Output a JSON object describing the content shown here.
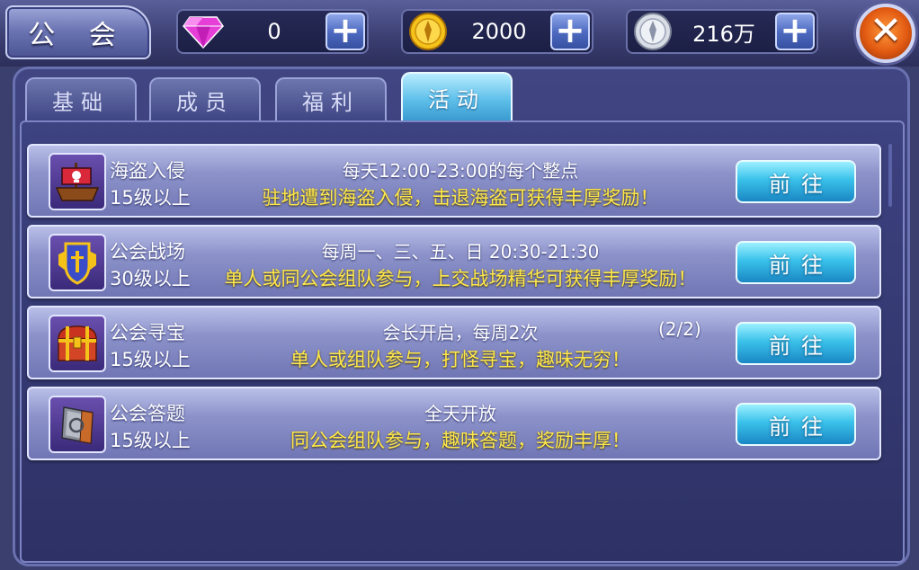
{
  "title": "公 会",
  "currencies": [
    {
      "icon": "gem-icon",
      "value": "0",
      "color": "#e63fd8"
    },
    {
      "icon": "gold-coin-icon",
      "value": "2000",
      "color": "#f5c21a"
    },
    {
      "icon": "silver-coin-icon",
      "value": "216万",
      "color": "#d9dde6"
    }
  ],
  "tabs": [
    {
      "label": "基础",
      "active": false
    },
    {
      "label": "成员",
      "active": false
    },
    {
      "label": "福利",
      "active": false
    },
    {
      "label": "活动",
      "active": true
    }
  ],
  "activities": [
    {
      "icon": "pirate-ship-icon",
      "name": "海盗入侵",
      "level": "15级以上",
      "time": "每天12:00-23:00的每个整点",
      "count": "",
      "desc": "驻地遭到海盗入侵，击退海盗可获得丰厚奖励！",
      "button": "前往"
    },
    {
      "icon": "guild-shield-icon",
      "name": "公会战场",
      "level": "30级以上",
      "time": "每周一、三、五、日 20:30-21:30",
      "count": "",
      "desc": "单人或同公会组队参与，上交战场精华可获得丰厚奖励！",
      "button": "前往"
    },
    {
      "icon": "treasure-chest-icon",
      "name": "公会寻宝",
      "level": "15级以上",
      "time": "会长开启，每周2次",
      "count": "(2/2)",
      "desc": "单人或组队参与，打怪寻宝，趣味无穷！",
      "button": "前往"
    },
    {
      "icon": "quiz-book-icon",
      "name": "公会答题",
      "level": "15级以上",
      "time": "全天开放",
      "count": "",
      "desc": "同公会组队参与，趣味答题，奖励丰厚！",
      "button": "前往"
    }
  ]
}
